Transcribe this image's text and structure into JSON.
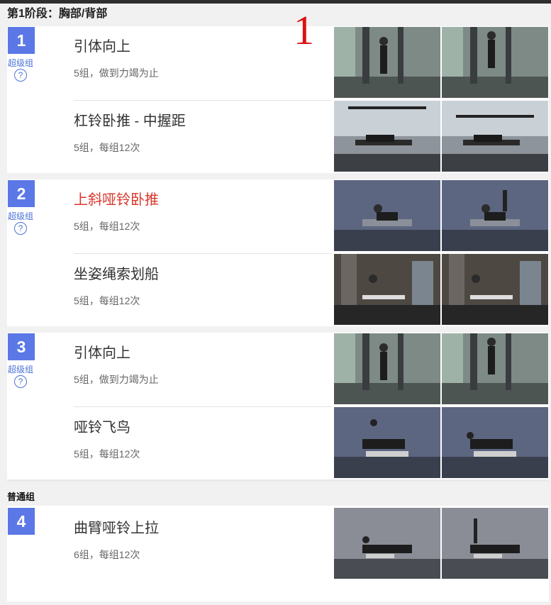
{
  "page": {
    "stage_title": "第1阶段：胸部/背部",
    "annotation": "1",
    "plain_group_title": "普通组"
  },
  "groups": [
    {
      "number": "2",
      "type": "超级组",
      "help": "?",
      "exercises": [
        {
          "name": "上斜哑铃卧推",
          "sets": "5组，每组12次",
          "highlight": true
        },
        {
          "name": "坐姿绳索划船",
          "sets": "5组，每组12次"
        }
      ]
    }
  ],
  "g1": {
    "number": "1",
    "type": "超级组",
    "help": "?",
    "ex1": {
      "name": "引体向上",
      "sets": "5组，做到力竭为止"
    },
    "ex2": {
      "name": "杠铃卧推 - 中握距",
      "sets": "5组，每组12次"
    }
  },
  "g2": {
    "number": "2",
    "type": "超级组",
    "help": "?",
    "ex1": {
      "name": "上斜哑铃卧推",
      "sets": "5组，每组12次"
    },
    "ex2": {
      "name": "坐姿绳索划船",
      "sets": "5组，每组12次"
    }
  },
  "g3": {
    "number": "3",
    "type": "超级组",
    "help": "?",
    "ex1": {
      "name": "引体向上",
      "sets": "5组，做到力竭为止"
    },
    "ex2": {
      "name": "哑铃飞鸟",
      "sets": "5组，每组12次"
    }
  },
  "g4": {
    "number": "4",
    "ex1": {
      "name": "曲臂哑铃上拉",
      "sets": "6组，每组12次"
    }
  },
  "colors": {
    "number_badge": "#5b78e6",
    "group_type": "#4a72d8",
    "highlight_name": "#d9352b",
    "annotation": "#dd1111"
  },
  "icons": [
    "question-circle-icon"
  ]
}
